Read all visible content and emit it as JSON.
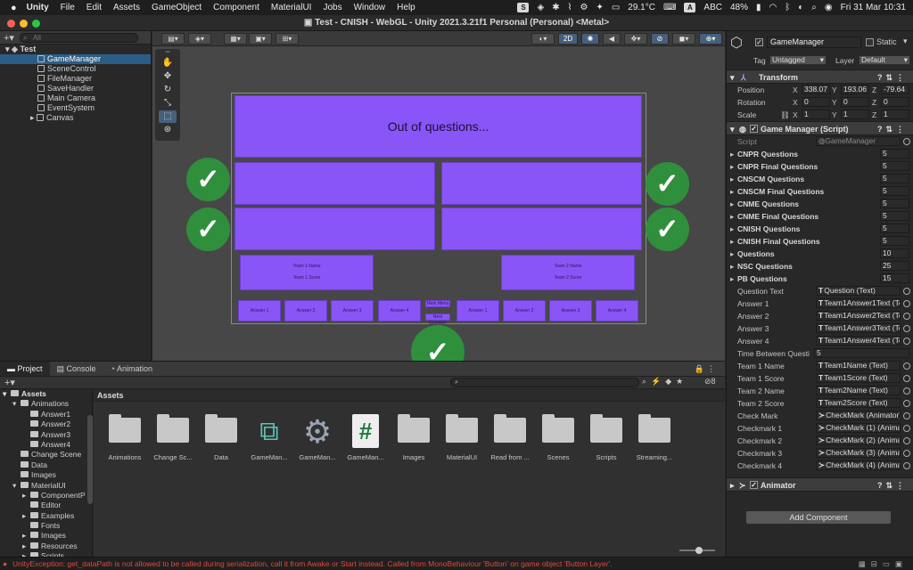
{
  "menubar": {
    "items": [
      "Unity",
      "File",
      "Edit",
      "Assets",
      "GameObject",
      "Component",
      "MaterialUI",
      "Jobs",
      "Window",
      "Help"
    ],
    "s_badge": "S",
    "temperature": "29.1°C",
    "a_badge": "A",
    "input_source": "ABC",
    "battery": "48%",
    "datetime": "Fri 31 Mar  10:31"
  },
  "window_title": "Test - CNISH - WebGL - Unity 2021.3.21f1 Personal (Personal) <Metal>",
  "hierarchy": {
    "search_placeholder": "All",
    "scene": "Test",
    "items": [
      "GameManager",
      "SceneControl",
      "FileManager",
      "SaveHandler",
      "Main Camera",
      "EventSystem",
      "Canvas"
    ]
  },
  "scene_toolbar": {
    "mode_2d": "2D"
  },
  "scene": {
    "question": "Out of questions...",
    "team1_name": "Team 1 Name",
    "team1_score": "Team 1 Score",
    "team2_name": "Team 2 Name",
    "team2_score": "Team 2 Score",
    "answers": [
      "Answer 1",
      "Answer 2",
      "Answer 3",
      "Answer 4",
      "Answer 1",
      "Answer 2",
      "Answer 3",
      "Answer 4"
    ],
    "mid_top": "Main Menu",
    "mid_bottom": "Next Question"
  },
  "inspector": {
    "object_name": "GameManager",
    "static_label": "Static",
    "tag_label": "Tag",
    "tag_value": "Untagged",
    "layer_label": "Layer",
    "layer_value": "Default",
    "transform": {
      "title": "Transform",
      "rows": [
        {
          "label": "Position",
          "x": "338.07",
          "y": "193.06",
          "z": "-79.64"
        },
        {
          "label": "Rotation",
          "x": "0",
          "y": "0",
          "z": "0"
        },
        {
          "label": "Scale",
          "x": "1",
          "y": "1",
          "z": "1"
        }
      ]
    },
    "script_component": {
      "title": "Game Manager (Script)",
      "script_label": "Script",
      "script_value": "GameManager",
      "lists": [
        {
          "label": "CNPR Questions",
          "value": "5"
        },
        {
          "label": "CNPR Final Questions",
          "value": "5"
        },
        {
          "label": "CNSCM Questions",
          "value": "5"
        },
        {
          "label": "CNSCM Final Questions",
          "value": "5"
        },
        {
          "label": "CNME Questions",
          "value": "5"
        },
        {
          "label": "CNME Final Questions",
          "value": "5"
        },
        {
          "label": "CNISH Questions",
          "value": "5"
        },
        {
          "label": "CNISH Final Questions",
          "value": "5"
        },
        {
          "label": "Questions",
          "value": "10"
        },
        {
          "label": "NSC Questions",
          "value": "25"
        },
        {
          "label": "PB Questions",
          "value": "15"
        }
      ],
      "refs": [
        {
          "label": "Question Text",
          "value": "Question (Text)"
        },
        {
          "label": "Answer 1",
          "value": "Team1Answer1Text (Text)"
        },
        {
          "label": "Answer 2",
          "value": "Team1Answer2Text (Text)"
        },
        {
          "label": "Answer 3",
          "value": "Team1Answer3Text (Text)"
        },
        {
          "label": "Answer 4",
          "value": "Team1Answer4Text (Text)"
        }
      ],
      "time_label": "Time Between Questi",
      "time_value": "5",
      "refs2": [
        {
          "label": "Team 1 Name",
          "value": "Team1Name (Text)"
        },
        {
          "label": "Team 1 Score",
          "value": "Team1Score (Text)"
        },
        {
          "label": "Team 2 Name",
          "value": "Team2Name (Text)"
        },
        {
          "label": "Team 2 Score",
          "value": "Team2Score (Text)"
        },
        {
          "label": "Check Mark",
          "value": "CheckMark (Animator)"
        },
        {
          "label": "Checkmark 1",
          "value": "CheckMark (1) (Animator)"
        },
        {
          "label": "Checkmark 2",
          "value": "CheckMark (2) (Animator)"
        },
        {
          "label": "Checkmark 3",
          "value": "CheckMark (3) (Animator)"
        },
        {
          "label": "Checkmark 4",
          "value": "CheckMark (4) (Animator)"
        }
      ]
    },
    "animator_title": "Animator",
    "add_component": "Add Component"
  },
  "project": {
    "tabs": [
      "Project",
      "Console",
      "Animation"
    ],
    "badge_count": "8",
    "assets_header": "Assets",
    "tree": [
      {
        "label": "Assets",
        "indent": 0,
        "arrow": "▾"
      },
      {
        "label": "Animations",
        "indent": 1,
        "arrow": "▾"
      },
      {
        "label": "Answer1",
        "indent": 2,
        "arrow": ""
      },
      {
        "label": "Answer2",
        "indent": 2,
        "arrow": ""
      },
      {
        "label": "Answer3",
        "indent": 2,
        "arrow": ""
      },
      {
        "label": "Answer4",
        "indent": 2,
        "arrow": ""
      },
      {
        "label": "Change Scene",
        "indent": 1,
        "arrow": ""
      },
      {
        "label": "Data",
        "indent": 1,
        "arrow": ""
      },
      {
        "label": "Images",
        "indent": 1,
        "arrow": ""
      },
      {
        "label": "MaterialUI",
        "indent": 1,
        "arrow": "▾"
      },
      {
        "label": "ComponentP",
        "indent": 2,
        "arrow": "▸"
      },
      {
        "label": "Editor",
        "indent": 2,
        "arrow": ""
      },
      {
        "label": "Examples",
        "indent": 2,
        "arrow": "▸"
      },
      {
        "label": "Fonts",
        "indent": 2,
        "arrow": ""
      },
      {
        "label": "Images",
        "indent": 2,
        "arrow": "▸"
      },
      {
        "label": "Resources",
        "indent": 2,
        "arrow": "▸"
      },
      {
        "label": "Scripts",
        "indent": 2,
        "arrow": "▸"
      }
    ],
    "assets": [
      {
        "label": "Animations",
        "kind": "folder"
      },
      {
        "label": "Change Sc...",
        "kind": "folder"
      },
      {
        "label": "Data",
        "kind": "folder"
      },
      {
        "label": "GameMan...",
        "kind": "prefab"
      },
      {
        "label": "GameMan...",
        "kind": "gear"
      },
      {
        "label": "GameMan...",
        "kind": "script"
      },
      {
        "label": "Images",
        "kind": "folder"
      },
      {
        "label": "MaterialUI",
        "kind": "folder"
      },
      {
        "label": "Read from ...",
        "kind": "folder"
      },
      {
        "label": "Scenes",
        "kind": "folder"
      },
      {
        "label": "Scripts",
        "kind": "folder"
      },
      {
        "label": "Streaming...",
        "kind": "folder"
      }
    ]
  },
  "status": "UnityException: get_dataPath is not allowed to be called during serialization, call it from Awake or Start instead. Called from MonoBehaviour 'Button' on game object 'Button Layer'."
}
